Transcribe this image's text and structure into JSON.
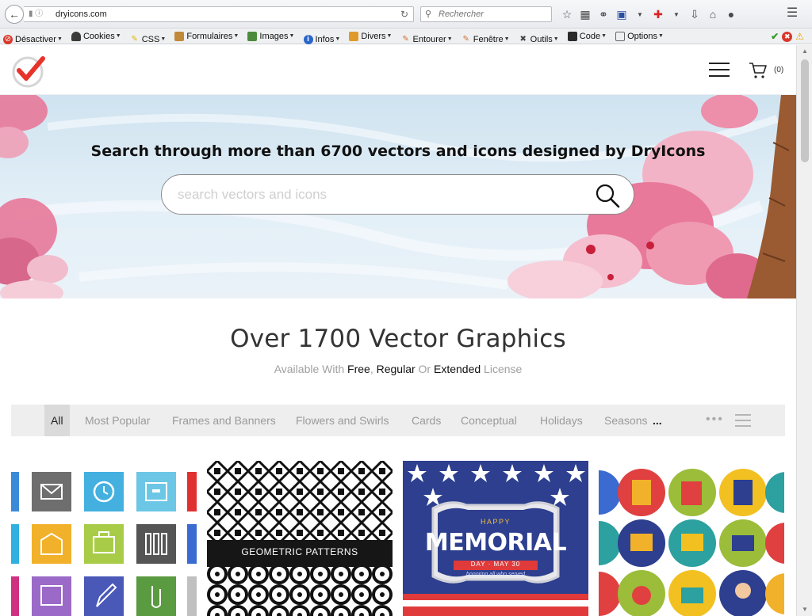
{
  "browser": {
    "url": "dryicons.com",
    "search_placeholder": "Rechercher"
  },
  "devtoolbar": {
    "items": [
      {
        "label": "Désactiver",
        "icon": "disable-icon",
        "color": "#d8372a"
      },
      {
        "label": "Cookies",
        "icon": "cookie-icon",
        "color": "#3b3b3b"
      },
      {
        "label": "CSS",
        "icon": "pencil-icon",
        "color": "#e8b400"
      },
      {
        "label": "Formulaires",
        "icon": "clipboard-icon",
        "color": "#c08a3a"
      },
      {
        "label": "Images",
        "icon": "image-icon",
        "color": "#4a8a3a"
      },
      {
        "label": "Infos",
        "icon": "info-icon",
        "color": "#2a66c8"
      },
      {
        "label": "Divers",
        "icon": "folder-icon",
        "color": "#e09a2a"
      },
      {
        "label": "Entourer",
        "icon": "pen-icon",
        "color": "#d07030"
      },
      {
        "label": "Fenêtre",
        "icon": "pen-icon",
        "color": "#d07030"
      },
      {
        "label": "Outils",
        "icon": "tools-icon",
        "color": "#444444"
      },
      {
        "label": "Code",
        "icon": "code-icon",
        "color": "#2a2a2a"
      },
      {
        "label": "Options",
        "icon": "options-icon",
        "color": "#666666"
      }
    ]
  },
  "site": {
    "cart_count": "(0)",
    "hero": {
      "title": "Search through more than 6700 vectors and icons designed by DryIcons",
      "search_placeholder": "search vectors and icons"
    },
    "section_title": "Over 1700 Vector Graphics",
    "subline": {
      "prefix": "Available With",
      "free": "Free",
      "regular": "Regular",
      "or": "Or",
      "extended": "Extended",
      "suffix": "License"
    },
    "filters": [
      "All",
      "Most Popular",
      "Frames and Banners",
      "Flowers and Swirls",
      "Cards",
      "Conceptual",
      "Holidays",
      "Seasons"
    ],
    "filters_ellipsis": "...",
    "filters_more": "•••",
    "cards": [
      {
        "name": "office-icons-card",
        "caption": ""
      },
      {
        "name": "geometric-patterns-card",
        "caption": "GEOMETRIC PATTERNS"
      },
      {
        "name": "memorial-day-card",
        "caption_top": "HAPPY",
        "caption_main": "MEMORIAL",
        "caption_date": "DAY · MAY 30",
        "caption_sub": "honoring all who served"
      },
      {
        "name": "flat-round-icons-card",
        "caption": ""
      }
    ]
  }
}
